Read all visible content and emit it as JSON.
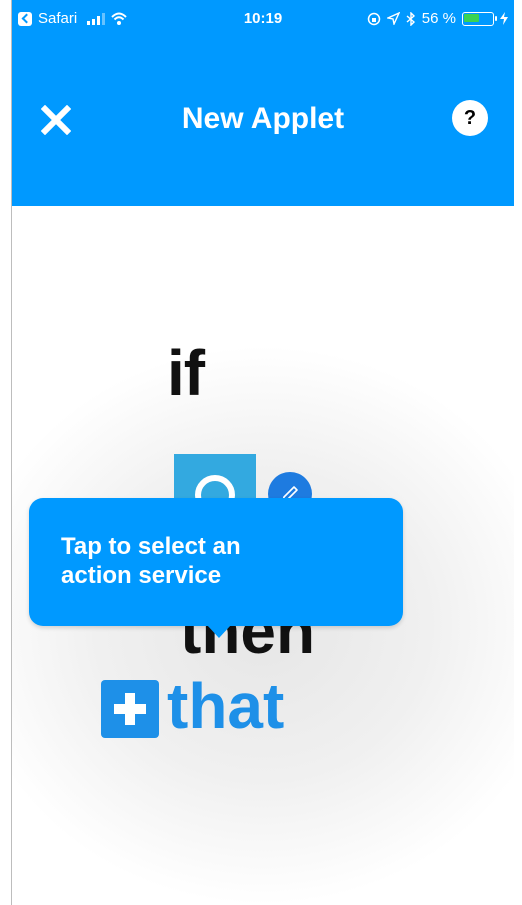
{
  "status_bar": {
    "back_app": "Safari",
    "time": "10:19",
    "battery_percent": "56 %",
    "battery_level": 0.56
  },
  "header": {
    "title": "New Applet"
  },
  "builder": {
    "if_word": "if",
    "then_word": "then",
    "that_word": "that"
  },
  "tooltip": {
    "line1": "Tap to select an",
    "line2": "action service"
  },
  "colors": {
    "brand_blue": "#0099ff",
    "that_blue": "#1e90e8",
    "trigger_tile": "#33a9e0",
    "edit_blue": "#1e7be0"
  },
  "icons": {
    "close": "close-icon",
    "help": "question-icon",
    "edit": "pencil-icon",
    "add": "plus-icon"
  }
}
